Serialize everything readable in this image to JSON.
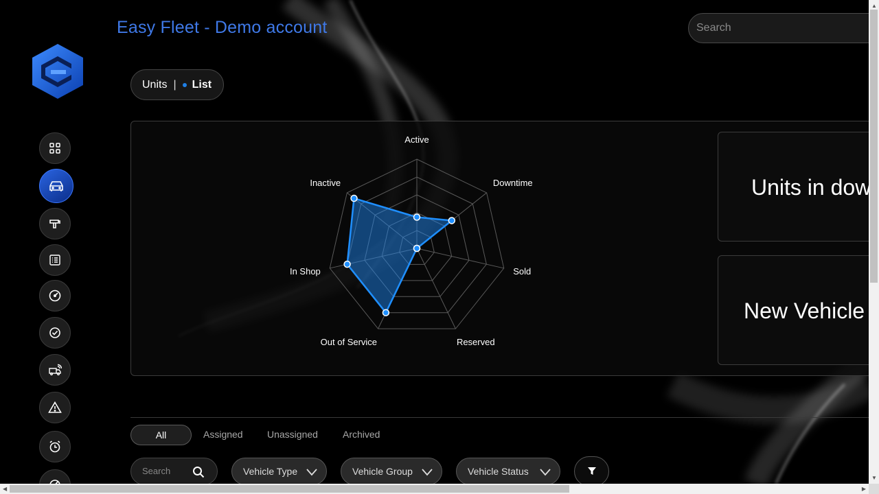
{
  "app": {
    "title": "Easy Fleet - Demo account"
  },
  "search": {
    "placeholder": "Search"
  },
  "view_toggle": {
    "units_label": "Units",
    "separator": "|",
    "list_label": "List"
  },
  "sidebar": {
    "items": [
      {
        "icon": "dashboard-grid-icon"
      },
      {
        "icon": "car-icon",
        "active": true
      },
      {
        "icon": "fuel-pump-icon"
      },
      {
        "icon": "checklist-icon"
      },
      {
        "icon": "speedometer-icon"
      },
      {
        "icon": "check-circle-icon"
      },
      {
        "icon": "connected-truck-icon"
      },
      {
        "icon": "warning-icon"
      },
      {
        "icon": "alarm-clock-icon"
      },
      {
        "icon": "gauge-icon"
      }
    ]
  },
  "chart_data": {
    "type": "radar",
    "categories": [
      "Active",
      "Downtime",
      "Sold",
      "Reserved",
      "Out of Service",
      "In Shop",
      "Inactive"
    ],
    "values": [
      3.5,
      5,
      0,
      0,
      8,
      8,
      9
    ],
    "rmax": 10,
    "rings": 5,
    "color": "#1f8fff"
  },
  "cards": {
    "downtime_title": "Units in downtime",
    "new_vehicle_title": "New Vehicle A"
  },
  "tabs": [
    "All",
    "Assigned",
    "Unassigned",
    "Archived"
  ],
  "filters": {
    "search_placeholder": "Search",
    "vehicle_type": "Vehicle Type",
    "vehicle_group": "Vehicle Group",
    "vehicle_status": "Vehicle Status"
  },
  "colors": {
    "accent": "#3f79e8",
    "radar": "#1f8fff",
    "active_sidebar": "#2a64e0"
  }
}
